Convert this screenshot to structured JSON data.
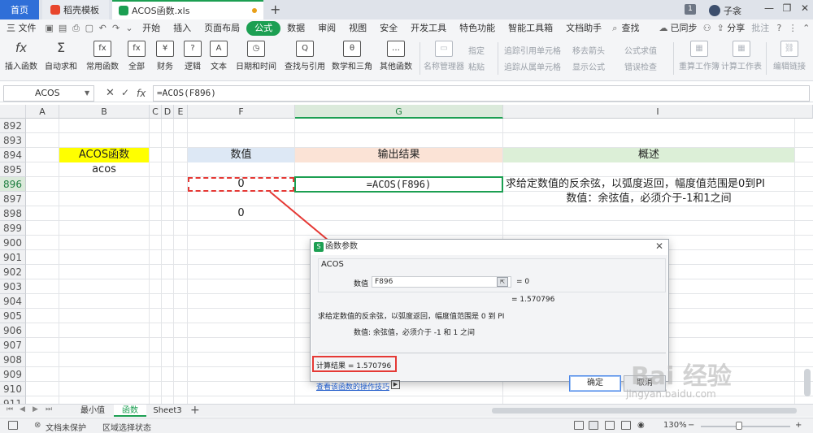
{
  "titlebar": {
    "tabs": [
      "首页",
      "稻壳模板",
      "ACOS函数.xls"
    ],
    "window_count": "1",
    "user_name": "子衾"
  },
  "menubar": {
    "file_label": "三 文件",
    "items": [
      "开始",
      "插入",
      "页面布局",
      "公式",
      "数据",
      "审阅",
      "视图",
      "安全",
      "开发工具",
      "特色功能",
      "智能工具箱",
      "文档助手"
    ],
    "active_item": "公式",
    "search_label": "查找",
    "sync_label": "已同步",
    "share_label": "分享",
    "comment_label": "批注"
  },
  "ribbon": {
    "buttons": [
      {
        "label": "插入函数",
        "icon": "fx"
      },
      {
        "label": "自动求和",
        "icon": "Σ"
      },
      {
        "label": "常用函数",
        "icon": "fx"
      },
      {
        "label": "全部",
        "icon": "fx"
      },
      {
        "label": "财务",
        "icon": "¥"
      },
      {
        "label": "逻辑",
        "icon": "?"
      },
      {
        "label": "文本",
        "icon": "A"
      },
      {
        "label": "日期和时间",
        "icon": "◷"
      },
      {
        "label": "查找与引用",
        "icon": "Q"
      },
      {
        "label": "数学和三角",
        "icon": "θ"
      },
      {
        "label": "其他函数",
        "icon": "…"
      }
    ],
    "name_manager": "名称管理器",
    "specify": "指定",
    "paste": "粘贴",
    "trace_precedents": "追踪引用单元格",
    "trace_dependents": "追踪从属单元格",
    "remove_arrows": "移去箭头",
    "show_formulas": "显示公式",
    "formula_eval": "公式求值",
    "error_check": "错误检查",
    "recalc_sheet": "重算工作簿",
    "calc_sheet": "计算工作表",
    "edit_links": "编辑链接"
  },
  "formulabar": {
    "namebox": "ACOS",
    "formula": "=ACOS(F896)"
  },
  "grid": {
    "columns": [
      "A",
      "B",
      "C",
      "D",
      "E",
      "F",
      "G",
      "I"
    ],
    "rows": [
      "892",
      "893",
      "894",
      "895",
      "896",
      "897",
      "898",
      "899",
      "900",
      "901",
      "902",
      "903",
      "904",
      "905",
      "906",
      "907",
      "908",
      "909",
      "910",
      "911"
    ],
    "selected_row": "896",
    "selected_column": "G",
    "cells": {
      "b894": "ACOS函数",
      "b895": "acos",
      "f894": "数值",
      "g894": "输出结果",
      "i894": "概述",
      "f896": "0",
      "g896": "=ACOS(F896)",
      "i896": "求给定数值的反余弦，以弧度返回，幅度值范围是0到PI",
      "i897": "数值：余弦值，必须介于-1和1之间",
      "f898": "0"
    },
    "colors": {
      "header_yellow": "#ffff00",
      "header_blue": "#dde8f5",
      "header_peach": "#fbe3d6",
      "header_green": "#dcefd7",
      "highlight_red": "#e53935"
    }
  },
  "dialog": {
    "title": "函数参数",
    "function_name": "ACOS",
    "arg_label": "数值",
    "arg_value": "F896",
    "arg_result": "= 0",
    "func_result": "= 1.570796",
    "description": "求给定数值的反余弦，以弧度返回，幅度值范围是 0 到 PI",
    "arg_description": "数值:  余弦值，必须介于 -1 和 1 之间",
    "calc_result": "计算结果 = 1.570796",
    "help_link": "查看该函数的操作技巧",
    "ok_label": "确定",
    "cancel_label": "取消"
  },
  "sheets": {
    "tabs": [
      "最小值",
      "函数",
      "Sheet3"
    ],
    "active": "函数"
  },
  "statusbar": {
    "protect": "文档未保护",
    "selection": "区域选择状态",
    "zoom": "130%"
  },
  "watermark": {
    "text": "Bai 经验",
    "url": "jingyan.baidu.com"
  }
}
